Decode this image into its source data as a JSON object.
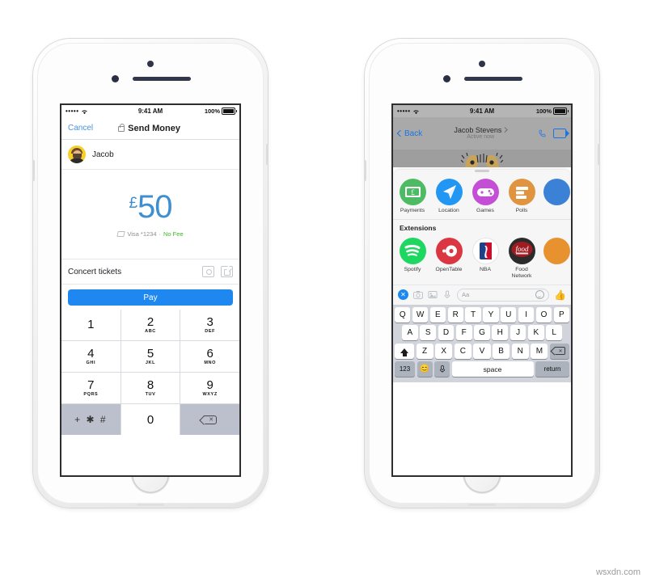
{
  "watermark": "wsxdn.com",
  "left_phone": {
    "status_bar": {
      "signal": "•••••",
      "wifi": "wifi-icon",
      "time": "9:41 AM",
      "battery_pct": "100%"
    },
    "nav": {
      "cancel_label": "Cancel",
      "title": "Send Money",
      "lock_icon": "lock-icon"
    },
    "recipient": {
      "name": "Jacob",
      "avatar": "jacob-avatar"
    },
    "amount": {
      "currency": "£",
      "value": "50",
      "color": "#3f8fd0"
    },
    "funding": {
      "card": "Visa *1234",
      "separator": "·",
      "fee_label": "No Fee",
      "fee_color": "#42b72a"
    },
    "memo": {
      "text": "Concert tickets",
      "camera_icon": "camera-icon",
      "gif_icon": "gif-icon"
    },
    "pay_button": {
      "label": "Pay",
      "color": "#1f87f0"
    },
    "keypad": {
      "keys": [
        {
          "num": "1",
          "sub": ""
        },
        {
          "num": "2",
          "sub": "ABC"
        },
        {
          "num": "3",
          "sub": "DEF"
        },
        {
          "num": "4",
          "sub": "GHI"
        },
        {
          "num": "5",
          "sub": "JKL"
        },
        {
          "num": "6",
          "sub": "MNO"
        },
        {
          "num": "7",
          "sub": "PQRS"
        },
        {
          "num": "8",
          "sub": "TUV"
        },
        {
          "num": "9",
          "sub": "WXYZ"
        }
      ],
      "symbol_key": "+ ✱ #",
      "zero_key": "0",
      "delete_key": "delete-icon"
    }
  },
  "right_phone": {
    "status_bar": {
      "signal": "•••••",
      "wifi": "wifi-icon",
      "time": "9:41 AM",
      "battery_pct": "100%"
    },
    "nav": {
      "back_label": "Back",
      "thread_name": "Jacob Stevens",
      "thread_status": "Active now",
      "phone_icon": "phone-icon",
      "video_icon": "video-camera-icon"
    },
    "sheet": {
      "apps": [
        {
          "label": "Payments",
          "icon": "payments-icon",
          "color": "#4cbb63"
        },
        {
          "label": "Location",
          "icon": "location-icon",
          "color": "#2196f3"
        },
        {
          "label": "Games",
          "icon": "games-icon",
          "color": "#c44fd6"
        },
        {
          "label": "Polls",
          "icon": "polls-icon",
          "color": "#e0943f"
        }
      ],
      "apps_partial_color": "#3b82d6",
      "extensions_header": "Extensions",
      "extensions": [
        {
          "label": "Spotify",
          "icon": "spotify-icon",
          "color": "#1ed760"
        },
        {
          "label": "OpenTable",
          "icon": "opentable-icon",
          "color": "#da3743"
        },
        {
          "label": "NBA",
          "icon": "nba-icon",
          "color": "#ffffff"
        },
        {
          "label": "Food Network",
          "icon": "food-network-icon",
          "color": "#9e1b22"
        }
      ],
      "extensions_partial_color": "#e8922f"
    },
    "composer": {
      "close_label": "✕",
      "camera_icon": "camera-icon",
      "photo_icon": "photo-icon",
      "mic_icon": "microphone-icon",
      "input_placeholder": "Aa",
      "emoji_icon": "smiley-icon",
      "like_icon": "thumbs-up-icon"
    },
    "keyboard": {
      "row1": [
        "Q",
        "W",
        "E",
        "R",
        "T",
        "Y",
        "U",
        "I",
        "O",
        "P"
      ],
      "row2": [
        "A",
        "S",
        "D",
        "F",
        "G",
        "H",
        "J",
        "K",
        "L"
      ],
      "row3": [
        "Z",
        "X",
        "C",
        "V",
        "B",
        "N",
        "M"
      ],
      "shift_key": "shift-icon",
      "delete_key": "delete-icon",
      "numbers_key": "123",
      "emoji_key": "😊",
      "dictation_key": "microphone-icon",
      "space_key": "space",
      "return_key": "return"
    }
  }
}
